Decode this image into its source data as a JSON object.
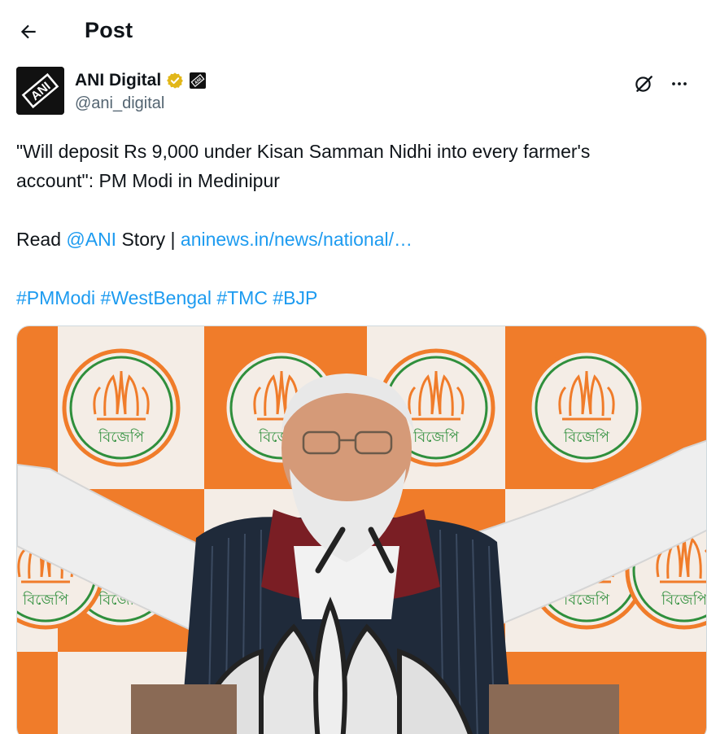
{
  "header": {
    "title": "Post",
    "back_icon": "arrow-left-icon"
  },
  "author": {
    "display_name": "ANI Digital",
    "handle": "@ani_digital",
    "verified_icon": "verified-badge-icon",
    "affiliate_badge_text": "ANI",
    "avatar_text": "ANI",
    "actions": [
      "grok-icon",
      "more-icon"
    ]
  },
  "tweet": {
    "line1": "\"Will deposit Rs 9,000 under Kisan Samman Nidhi into every farmer's",
    "line2": "account\": PM Modi in Medinipur",
    "read_prefix": "Read ",
    "mention": "@ANI",
    "story_text": " Story | ",
    "url": "aninews.in/news/national/…",
    "hashtags": [
      "#PMModi",
      "#WestBengal",
      "#TMC",
      "#BJP"
    ]
  },
  "media": {
    "logo_text": "বিজেপি",
    "colors": {
      "orange": "#f07c2a",
      "green": "#2f8f3c",
      "cream": "#f4ede6"
    }
  }
}
